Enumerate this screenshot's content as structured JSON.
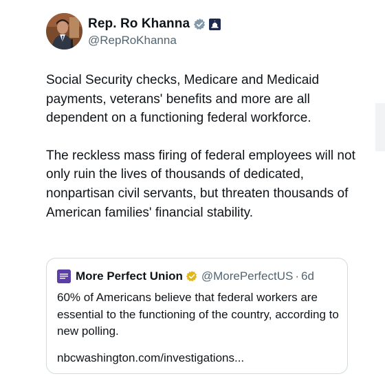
{
  "author": {
    "display_name": "Rep. Ro Khanna",
    "handle": "@RepRoKhanna",
    "avatar_icon": "profile-photo",
    "verified_badge_color": "#829aab",
    "gov_badge_icon": "capitol-building-icon"
  },
  "tweet": {
    "paragraphs": [
      "Social Security checks, Medicare and Medicaid payments, veterans' benefits and more are all dependent on a functioning federal workforce.",
      "The reckless mass firing of federal employees will not only ruin the lives of thousands of dedicated, nonpartisan civil servants, but threaten thousands of American families' financial stability."
    ]
  },
  "quote": {
    "display_name": "More Perfect Union",
    "handle": "@MorePerfectUS",
    "separator": "·",
    "time": "6d",
    "verified_badge_color": "#e2b719",
    "avatar_color": "#5b3fa6",
    "text": "60% of Americans believe that federal workers are essential to the functioning of the country, according to new polling.",
    "link": "nbcwashington.com/investigations..."
  }
}
